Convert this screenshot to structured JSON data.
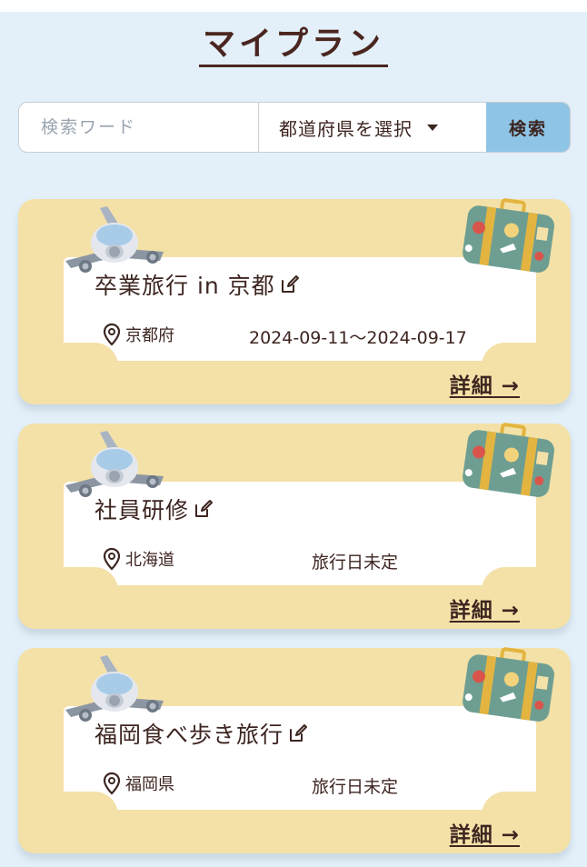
{
  "header": {
    "title": "マイプラン"
  },
  "search": {
    "placeholder": "検索ワード",
    "prefecture_label": "都道府県を選択",
    "button_label": "検索"
  },
  "plans": [
    {
      "title": "卒業旅行 in 京都",
      "location": "京都府",
      "dates": "2024-09-11〜2024-09-17",
      "detail_label": "詳細 →"
    },
    {
      "title": "社員研修",
      "location": "北海道",
      "dates": "旅行日未定",
      "detail_label": "詳細 →"
    },
    {
      "title": "福岡食べ歩き旅行",
      "location": "福岡県",
      "dates": "旅行日未定",
      "detail_label": "詳細 →"
    }
  ],
  "colors": {
    "background": "#e3f0f9",
    "card": "#f4e1a8",
    "accent_button": "#8ec5e6",
    "text": "#3d2520"
  },
  "icons": [
    "airplane-icon",
    "suitcase-icon",
    "edit-icon",
    "location-pin-icon",
    "chevron-down-icon"
  ]
}
